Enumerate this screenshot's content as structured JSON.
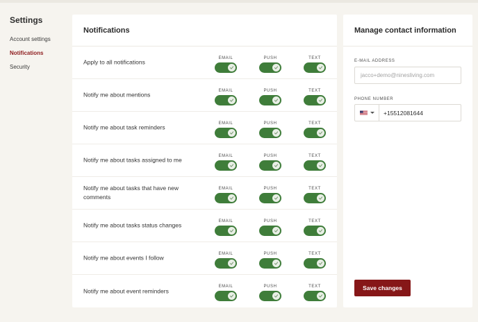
{
  "sidebar": {
    "title": "Settings",
    "items": [
      {
        "label": "Account settings",
        "active": false
      },
      {
        "label": "Notifications",
        "active": true
      },
      {
        "label": "Security",
        "active": false
      }
    ]
  },
  "notifications": {
    "title": "Notifications",
    "channels": [
      "EMAIL",
      "PUSH",
      "TEXT"
    ],
    "rows": [
      {
        "label": "Apply to all notifications",
        "email": true,
        "push": true,
        "text": true
      },
      {
        "label": "Notify me about mentions",
        "email": true,
        "push": true,
        "text": true
      },
      {
        "label": "Notify me about task reminders",
        "email": true,
        "push": true,
        "text": true
      },
      {
        "label": "Notify me about tasks assigned to me",
        "email": true,
        "push": true,
        "text": true
      },
      {
        "label": "Notify me about tasks that have new comments",
        "email": true,
        "push": true,
        "text": true
      },
      {
        "label": "Notify me about tasks status changes",
        "email": true,
        "push": true,
        "text": true
      },
      {
        "label": "Notify me about events I follow",
        "email": true,
        "push": true,
        "text": true
      },
      {
        "label": "Notify me about event reminders",
        "email": true,
        "push": true,
        "text": true
      }
    ]
  },
  "contact": {
    "title": "Manage contact information",
    "email_label": "E-MAIL ADDRESS",
    "email_placeholder": "jacco+demo@ninesliving.com",
    "email_value": "",
    "phone_label": "PHONE NUMBER",
    "phone_country": "us-flag-icon",
    "phone_value": "+15512081644",
    "save_label": "Save changes"
  },
  "colors": {
    "accent": "#861718",
    "toggle_on": "#3f7d3a",
    "background": "#f6f4ef"
  }
}
